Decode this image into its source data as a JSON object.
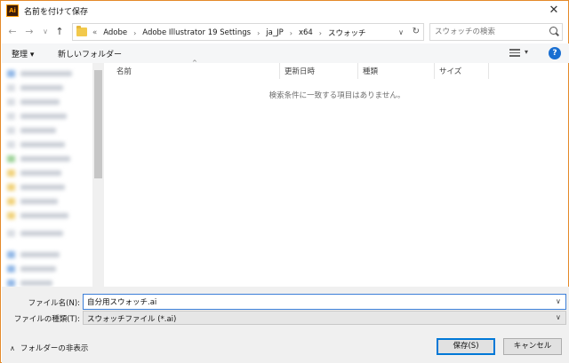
{
  "window": {
    "title": "名前を付けて保存",
    "app_icon_text": "Ai",
    "close_glyph": "✕"
  },
  "nav": {
    "back_glyph": "←",
    "forward_glyph": "→",
    "recent_glyph": "∨",
    "up_glyph": "↑"
  },
  "address": {
    "lead": "«",
    "crumbs": [
      "Adobe",
      "Adobe Illustrator 19 Settings",
      "ja_JP",
      "x64",
      "スウォッチ"
    ],
    "separator": "›",
    "dropdown_glyph": "∨",
    "refresh_glyph": "↻"
  },
  "search": {
    "placeholder": "スウォッチの検索"
  },
  "toolbar": {
    "organize_label": "整理 ▾",
    "new_folder_label": "新しいフォルダー",
    "view_dropdown_glyph": "▾",
    "help_glyph": "?"
  },
  "file_list": {
    "columns": [
      "名前",
      "更新日時",
      "種類",
      "サイズ"
    ],
    "sort_glyph": "^",
    "empty_message": "検索条件に一致する項目はありません。"
  },
  "form": {
    "filename_label": "ファイル名(N):",
    "filename_value": "自分用スウォッチ.ai",
    "filetype_label": "ファイルの種類(T):",
    "filetype_value": "スウォッチファイル (*.ai)",
    "dropdown_glyph": "∨"
  },
  "footer": {
    "hide_folders_glyph": "∧",
    "hide_folders_label": "フォルダーの非表示",
    "save_label": "保存(S)",
    "cancel_label": "キャンセル"
  },
  "colors": {
    "window_border": "#e48a2a",
    "accent": "#0078d7",
    "help": "#1a6fd1",
    "folder": "#f2c94c"
  }
}
